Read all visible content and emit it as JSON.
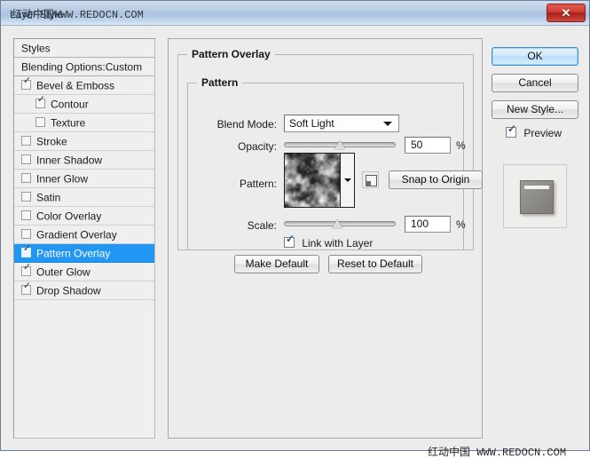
{
  "window": {
    "title": "Layer Style",
    "watermark_cn": "红动中国",
    "watermark_url": "WWW.REDOCN.COM",
    "close_glyph": "✕",
    "accent_selected": "#2196f3",
    "titlebar_color": "#b6cbe4",
    "close_color": "#c03a30"
  },
  "sidebar": {
    "header_label": "Styles",
    "blending_options_label": "Blending Options:Custom",
    "items": [
      {
        "label": "Bevel & Emboss",
        "checked": true,
        "indent": 0,
        "selected": false
      },
      {
        "label": "Contour",
        "checked": true,
        "indent": 1,
        "selected": false
      },
      {
        "label": "Texture",
        "checked": false,
        "indent": 1,
        "selected": false
      },
      {
        "label": "Stroke",
        "checked": false,
        "indent": 0,
        "selected": false
      },
      {
        "label": "Inner Shadow",
        "checked": false,
        "indent": 0,
        "selected": false
      },
      {
        "label": "Inner Glow",
        "checked": false,
        "indent": 0,
        "selected": false
      },
      {
        "label": "Satin",
        "checked": false,
        "indent": 0,
        "selected": false
      },
      {
        "label": "Color Overlay",
        "checked": false,
        "indent": 0,
        "selected": false
      },
      {
        "label": "Gradient Overlay",
        "checked": false,
        "indent": 0,
        "selected": false
      },
      {
        "label": "Pattern Overlay",
        "checked": true,
        "indent": 0,
        "selected": true
      },
      {
        "label": "Outer Glow",
        "checked": true,
        "indent": 0,
        "selected": false
      },
      {
        "label": "Drop Shadow",
        "checked": true,
        "indent": 0,
        "selected": false
      }
    ]
  },
  "main": {
    "group_title": "Pattern Overlay",
    "subgroup_title": "Pattern",
    "blend_mode": {
      "label": "Blend Mode:",
      "value": "Soft Light"
    },
    "opacity": {
      "label": "Opacity:",
      "value": "50",
      "unit": "%",
      "slider_percent": 50
    },
    "pattern": {
      "label": "Pattern:",
      "swatch_name": "clouds-texture",
      "snap_button": "Snap to Origin",
      "new_pattern_icon": "new-pattern-icon"
    },
    "scale": {
      "label": "Scale:",
      "value": "100",
      "unit": "%",
      "slider_percent": 48
    },
    "link_with_layer": {
      "label": "Link with Layer",
      "checked": true
    },
    "make_default": "Make Default",
    "reset_to_default": "Reset to Default"
  },
  "right": {
    "ok": "OK",
    "cancel": "Cancel",
    "new_style": "New Style...",
    "preview": {
      "label": "Preview",
      "checked": true
    }
  }
}
